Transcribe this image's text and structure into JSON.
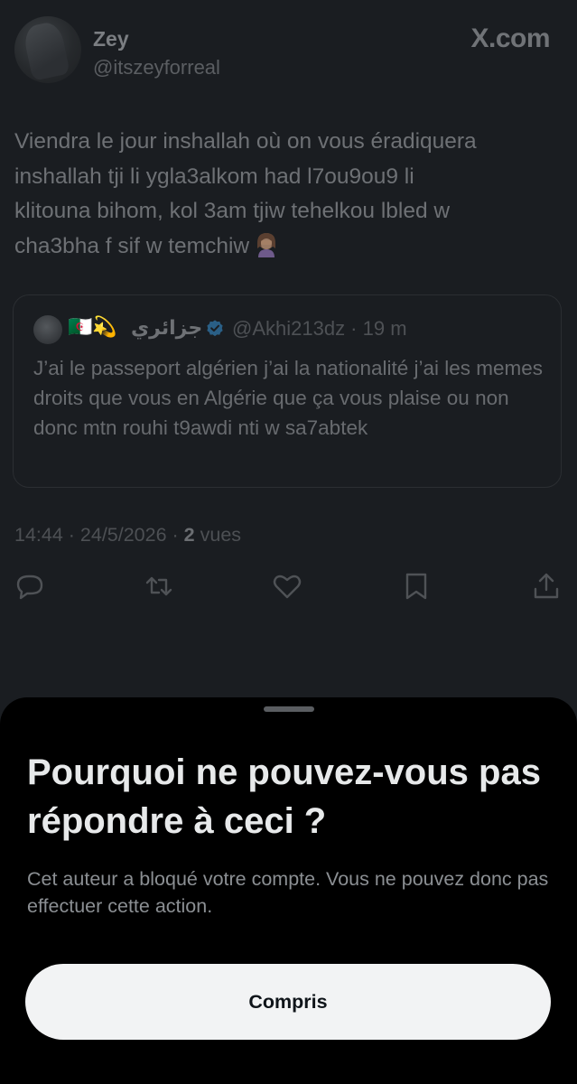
{
  "tweet": {
    "author_name": "Zey",
    "author_handle": "@itszeyforreal",
    "brand": "X.com",
    "text": "Viendra le jour inshallah où on vous éradiquera\ninshallah tji li ygla3alkom had l7ou9ou9 li\nklitouna bihom, kol 3am tjiw tehelkou lbled w\ncha3bha f sif w temchiw",
    "emoji": "woman-facepalming",
    "quote": {
      "flags": "🇩🇿💫",
      "name": "جزائري",
      "verified": true,
      "handle_time": "@Akhi213dz · 19 m",
      "text": "J’ai le passeport algérien j’ai la nationalité j’ai les memes droits que vous en Algérie que ça vous plaise ou non donc mtn rouhi t9awdi nti w sa7abtek"
    },
    "meta": {
      "timestamp": "14:44 · 24/5/2026 · ",
      "views_count": "2",
      "views_label": " vues"
    },
    "actions": [
      "reply-icon",
      "retweet-icon",
      "like-icon",
      "bookmark-icon",
      "share-icon"
    ]
  },
  "sheet": {
    "title": "Pourquoi ne pouvez-vous pas répondre à ceci ?",
    "body": "Cet auteur a bloqué votre compte. Vous ne pouvez donc pas effectuer cette action.",
    "button_label": "Compris"
  },
  "colors": {
    "background": "#1a1d21",
    "sheet": "#000000",
    "button": "#f2f3f4",
    "verified": "#1d9bf0"
  }
}
